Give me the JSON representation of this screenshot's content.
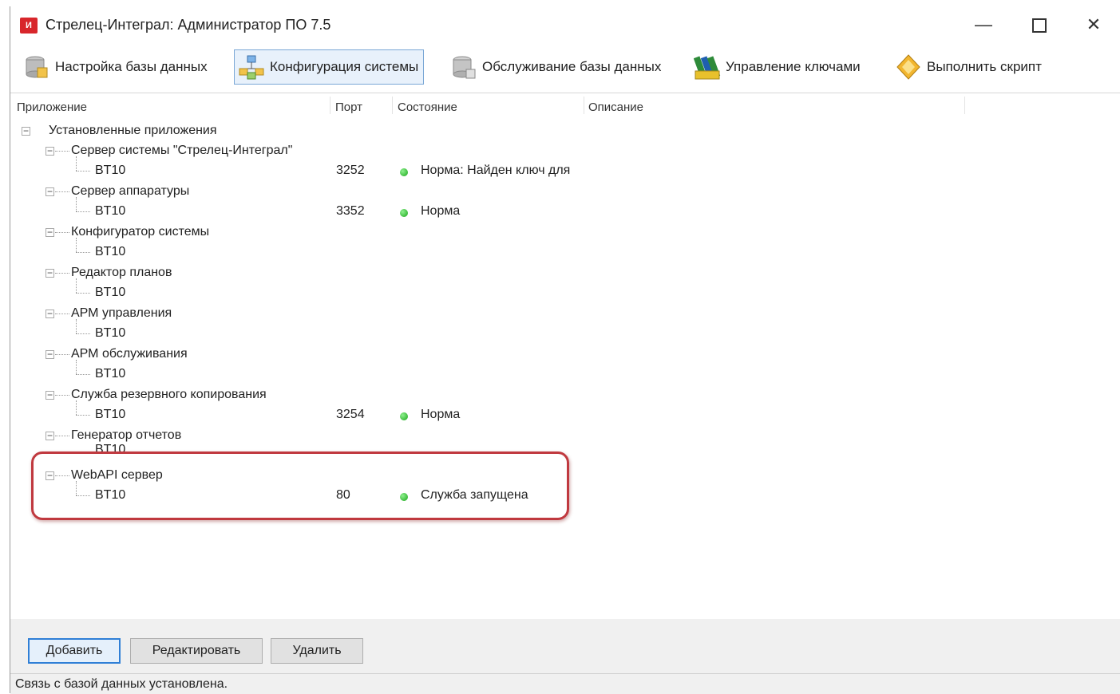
{
  "window": {
    "title": "Стрелец-Интеграл: Администратор ПО 7.5",
    "app_icon_text": "И",
    "minimize_glyph": "—",
    "close_glyph": "✕"
  },
  "toolbar": {
    "items": [
      {
        "label": "Настройка базы данных",
        "icon": "database-settings-icon"
      },
      {
        "label": "Конфигурация системы",
        "icon": "network-config-icon",
        "active": true
      },
      {
        "label": "Обслуживание базы данных",
        "icon": "database-service-icon"
      },
      {
        "label": "Управление ключами",
        "icon": "keys-icon"
      },
      {
        "label": "Выполнить скрипт",
        "icon": "script-icon"
      }
    ]
  },
  "columns": {
    "app": "Приложение",
    "port": "Порт",
    "status": "Состояние",
    "description": "Описание"
  },
  "tree": {
    "root": "Установленные приложения",
    "groups": [
      {
        "name": "Сервер системы \"Стрелец-Интеграл\"",
        "child": "BT10",
        "port": "3252",
        "status": "Норма: Найден ключ для"
      },
      {
        "name": "Сервер аппаратуры",
        "child": "BT10",
        "port": "3352",
        "status": "Норма"
      },
      {
        "name": "Конфигуратор системы",
        "child": "BT10",
        "port": "",
        "status": ""
      },
      {
        "name": "Редактор планов",
        "child": "BT10",
        "port": "",
        "status": ""
      },
      {
        "name": "АРМ управления",
        "child": "BT10",
        "port": "",
        "status": ""
      },
      {
        "name": "АРМ обслуживания",
        "child": "BT10",
        "port": "",
        "status": ""
      },
      {
        "name": "Служба резервного копирования",
        "child": "BT10",
        "port": "3254",
        "status": "Норма"
      },
      {
        "name": "Генератор отчетов",
        "child": "BT10",
        "port": "",
        "status": ""
      },
      {
        "name": "WebAPI сервер",
        "child": "BT10",
        "port": "80",
        "status": "Служба запущена"
      }
    ]
  },
  "buttons": {
    "add": "Добавить",
    "edit": "Редактировать",
    "delete": "Удалить"
  },
  "status_bar": {
    "text": "Связь с базой данных установлена."
  },
  "colors": {
    "status_ok": "#1aa61a",
    "highlight": "#c0393f",
    "active_tab": "#7aa7d6"
  }
}
